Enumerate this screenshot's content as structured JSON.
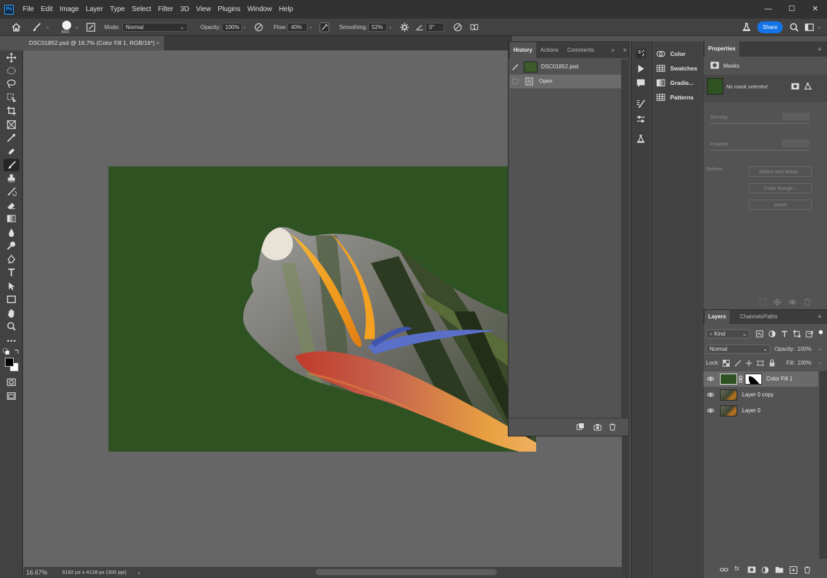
{
  "app": {
    "logo": "Ps"
  },
  "menu": [
    "File",
    "Edit",
    "Image",
    "Layer",
    "Type",
    "Select",
    "Filter",
    "3D",
    "View",
    "Plugins",
    "Window",
    "Help"
  ],
  "window_controls": {
    "minimize": "—",
    "maximize": "☐",
    "close": "✕"
  },
  "options": {
    "brush_size": "600",
    "mode_label": "Mode:",
    "mode_value": "Normal",
    "opacity_label": "Opacity:",
    "opacity_value": "100%",
    "flow_label": "Flow:",
    "flow_value": "40%",
    "smoothing_label": "Smoothing:",
    "smoothing_value": "52%",
    "angle_value": "0°",
    "share_label": "Share"
  },
  "document": {
    "tab_title": "DSC01852.psd @ 16.7% (Color Fill 1, RGB/16*)",
    "tab_close": "×",
    "fill_color": "#2f5223"
  },
  "status": {
    "zoom": "16.67%",
    "doc_info": "6192 px x 4128 px (300 ppi)",
    "arrow": "›"
  },
  "history": {
    "tabs": [
      "History",
      "Actions",
      "Comments"
    ],
    "items": [
      {
        "label": "DSC01852.psd"
      },
      {
        "label": "Open"
      }
    ]
  },
  "color_panel": {
    "items": [
      {
        "label": "Color",
        "icon": "color-wheel-icon"
      },
      {
        "label": "Swatches",
        "icon": "swatches-grid-icon"
      },
      {
        "label": "Gradie...",
        "icon": "gradient-icon"
      },
      {
        "label": "Patterns",
        "icon": "patterns-grid-icon"
      }
    ]
  },
  "properties": {
    "title": "Properties",
    "section": "Masks",
    "mask_status": "No mask selected",
    "density_label": "Density:",
    "feather_label": "Feather:",
    "refine_label": "Refine:",
    "select_and_mask": "Select and Mask...",
    "color_range": "Color Range...",
    "invert": "Invert"
  },
  "layers": {
    "tabs": [
      "Layers",
      "Channels",
      "Paths"
    ],
    "filter_kind": "Kind",
    "blend_mode": "Normal",
    "opacity_label": "Opacity:",
    "opacity_value": "100%",
    "lock_label": "Lock:",
    "fill_label": "Fill:",
    "fill_value": "100%",
    "items": [
      {
        "name": "Color Fill 1"
      },
      {
        "name": "Layer 0 copy"
      },
      {
        "name": "Layer 0"
      }
    ]
  },
  "colors": {
    "accent": "#1473e6",
    "fill_layer": "#2f5223",
    "panel_bg": "#535353",
    "canvas_bg": "#666666"
  }
}
